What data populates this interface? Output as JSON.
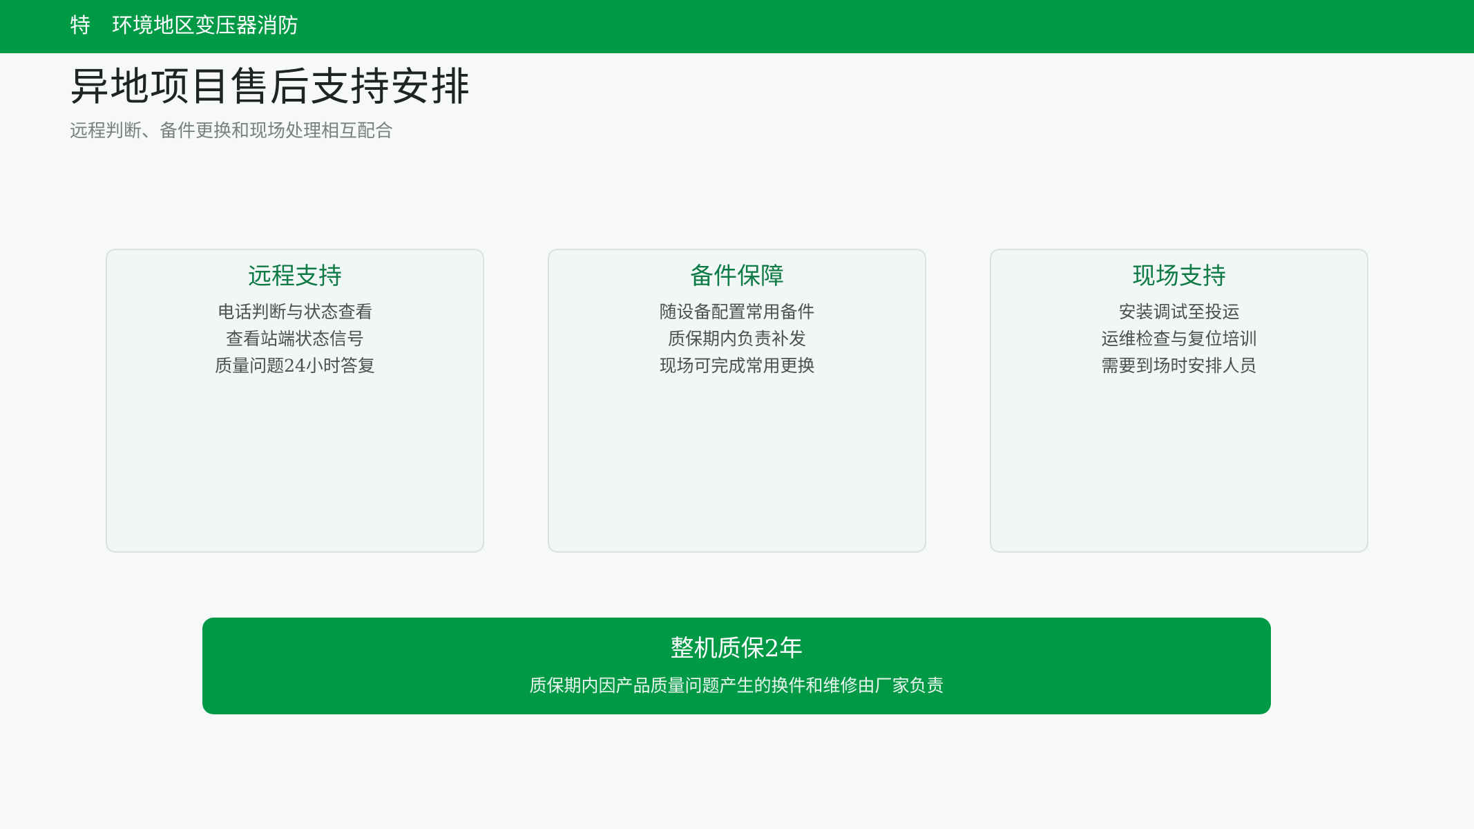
{
  "header": {
    "brand_mark": "特",
    "brand_title": "环境地区变压器消防"
  },
  "page": {
    "title": "异地项目售后支持安排",
    "subtitle": "远程判断、备件更换和现场处理相互配合"
  },
  "cards": [
    {
      "title": "远程支持",
      "lines": [
        "电话判断与状态查看",
        "查看站端状态信号",
        "质量问题24小时答复"
      ]
    },
    {
      "title": "备件保障",
      "lines": [
        "随设备配置常用备件",
        "质保期内负责补发",
        "现场可完成常用更换"
      ]
    },
    {
      "title": "现场支持",
      "lines": [
        "安装调试至投运",
        "运维检查与复位培训",
        "需要到场时安排人员"
      ]
    }
  ],
  "banner": {
    "title": "整机质保2年",
    "subtitle": "质保期内因产品质量问题产生的换件和维修由厂家负责"
  },
  "colors": {
    "accent": "#009a46",
    "card_title": "#0e7a45",
    "background": "#f6f9f8"
  }
}
